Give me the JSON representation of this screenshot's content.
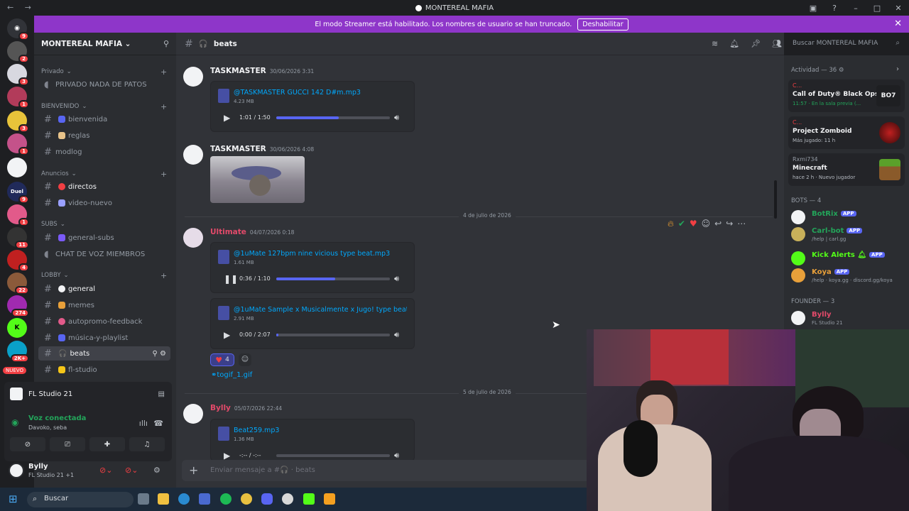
{
  "window": {
    "title": "MONTEREAL MAFIA",
    "nav_arrows": "← →"
  },
  "banner": {
    "text": "El modo Streamer está habilitado. Los nombres de usuario se han truncado.",
    "button": "Deshabilitar"
  },
  "rail": {
    "home_badge": "9",
    "badges": [
      "2",
      "3",
      "1",
      "3",
      "1",
      "9",
      "1",
      "11",
      "4",
      "22",
      "274",
      "2K+"
    ],
    "duel_label": "Duel",
    "new_label": "NUEVO"
  },
  "sidebar": {
    "server_name": "MONTEREAL MAFIA",
    "categories": {
      "privado": "Privado",
      "bienvenido": "BIENVENIDO",
      "anuncios": "Anuncios",
      "subs": "SUBS",
      "lobby": "LOBBY"
    },
    "channels": {
      "privado_nada": "PRIVADO NADA DE PATOS",
      "bienvenida": "bienvenida",
      "reglas": "reglas",
      "modlog": "modlog",
      "directos": "directos",
      "video_nuevo": "video-nuevo",
      "general_subs": "general-subs",
      "chat_voz": "CHAT DE VOZ MIEMBROS",
      "general": "general",
      "memes": "memes",
      "autopromo": "autopromo-feedback",
      "musica": "música-y-playlist",
      "beats": "beats",
      "fl_studio": "fl-studio"
    },
    "activity_row": "FL Studio 21",
    "voice": {
      "status": "Voz conectada",
      "sub": "Davoko, seba"
    },
    "user": {
      "name": "Bylly",
      "status": "FL Studio 21 +1"
    }
  },
  "header": {
    "channel": "beats",
    "search_placeholder": "Buscar MONTEREAL MAFIA"
  },
  "messages": [
    {
      "author": "TASKMASTER",
      "time": "30/06/2026 3:31",
      "file": "@TASKMASTER GUCCI 142 D#m.mp3",
      "size": "4.23 MB",
      "time_display": "1:01 / 1:50",
      "progress": 0.55
    },
    {
      "author": "TASKMASTER",
      "time": "30/06/2026 4:08"
    },
    {
      "author": "Ultimate",
      "time": "04/07/2026 0:18",
      "file": "@1uMate 127bpm nine vicious type beat.mp3",
      "size": "1.61 MB",
      "time_display": "0:36 / 1:10",
      "progress": 0.52
    },
    {
      "file": "@1uMate Sample x Musicalmente x Jugo! type beat.mp3",
      "size": "2.91 MB",
      "time_display": "0:00 / 2:07",
      "progress": 0.02
    },
    {
      "author": "Bylly",
      "time": "05/07/2026 22:44",
      "file": "Beat259.mp3",
      "size": "1.36 MB",
      "time_display": "-:-- / -:--",
      "progress": 0.0
    }
  ],
  "dividers": {
    "d1": "4 de julio de 2026",
    "d2": "5 de julio de 2026"
  },
  "reaction": {
    "count": "4"
  },
  "gif_link": "togif_1.gif",
  "composer_placeholder": "Enviar mensaje a #🎧 · beats",
  "members": {
    "activity_header": "Actividad — 36",
    "activities": [
      {
        "user": "C...",
        "game": "Call of Duty® Black Ops 7",
        "sub": "11:57 · En la sala previa (..."
      },
      {
        "user": "C...",
        "game": "Project Zomboid",
        "sub": "Más jugado: 11 h"
      },
      {
        "user": "Rxmi734",
        "game": "Minecraft",
        "sub": "hace 2 h · Nuevo jugador"
      }
    ],
    "bots_header": "BOTS — 4",
    "bots": [
      {
        "name": "BotRix",
        "sub": ""
      },
      {
        "name": "Carl-bot",
        "sub": "/help | carl.gg"
      },
      {
        "name": "Kick Alerts",
        "sub": ""
      },
      {
        "name": "Koya",
        "sub": "/help · koya.gg · discord.gg/koya"
      }
    ],
    "app_badge": "APP",
    "founder_header": "FOUNDER — 3",
    "founder": {
      "name": "Bylly",
      "sub": "FL Studio 21"
    }
  },
  "taskbar": {
    "search": "Buscar"
  },
  "colors": {
    "accent": "#5865f2",
    "banner": "#8e36c9",
    "link": "#00a8fc",
    "online": "#23a55a",
    "danger": "#f23f43"
  }
}
